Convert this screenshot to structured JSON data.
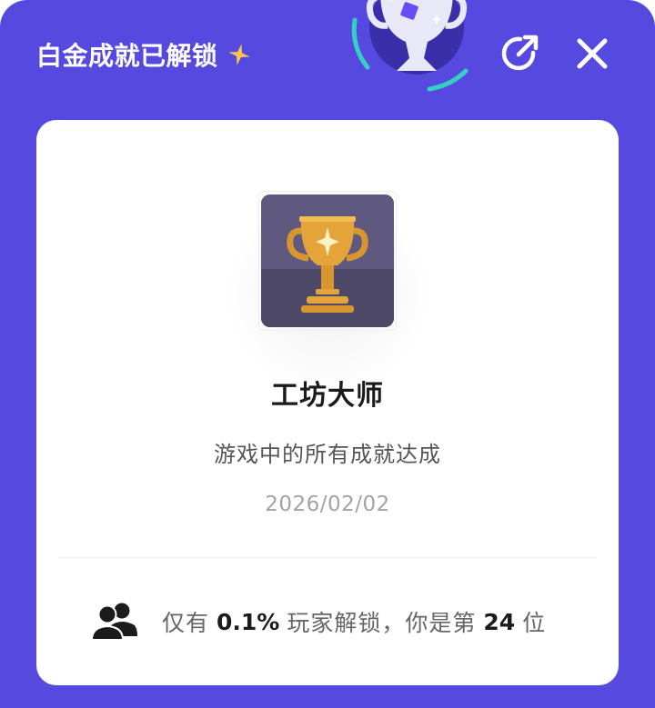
{
  "header": {
    "title": "白金成就已解锁",
    "sparkle_icon": "sparkle-icon",
    "trophy_badge_icon": "trophy-icon",
    "share_icon": "share-icon",
    "close_icon": "close-icon"
  },
  "achievement": {
    "name": "工坊大师",
    "description": "游戏中的所有成就达成",
    "date": "2026/02/02",
    "badge_icon": "gold-trophy-icon"
  },
  "stats": {
    "icon": "users-icon",
    "prefix": "仅有",
    "percent": "0.1%",
    "middle": "玩家解锁，你是第",
    "rank": "24",
    "suffix": "位"
  },
  "colors": {
    "panel_background": "#5549E0",
    "card_background": "#FFFFFF",
    "badge_tile": "#5F587F",
    "trophy_gold": "#E4A43A"
  }
}
